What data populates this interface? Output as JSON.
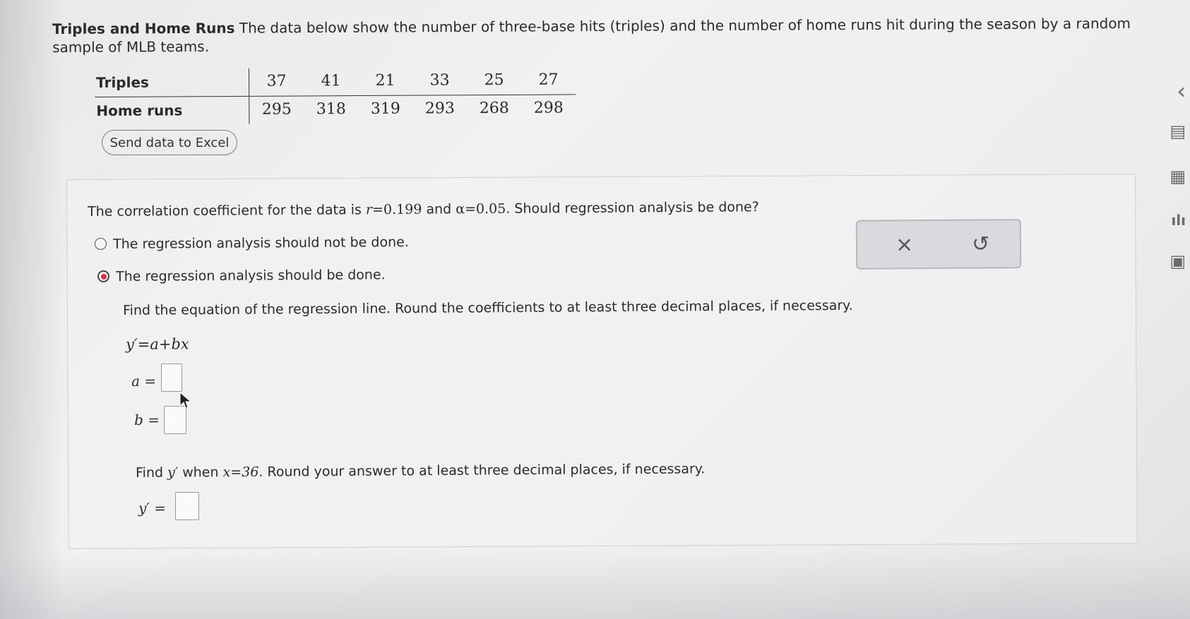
{
  "problem": {
    "title": "Triples and Home Runs",
    "description": "The data below show the number of three-base hits (triples) and the number of home runs hit during the season by a random sample of MLB teams."
  },
  "table": {
    "row1_label": "Triples",
    "row1_values": [
      "37",
      "41",
      "21",
      "33",
      "25",
      "27"
    ],
    "row2_label": "Home runs",
    "row2_values": [
      "295",
      "318",
      "319",
      "293",
      "268",
      "298"
    ]
  },
  "send_excel_label": "Send data to Excel",
  "question1": {
    "prefix": "The correlation coefficient for the data is",
    "r_var": "r",
    "r_eq": "=0.199",
    "mid": "and",
    "alpha": "α=0.05",
    "suffix": ". Should regression analysis be done?"
  },
  "options": [
    {
      "label": "The regression analysis should not be done.",
      "selected": false
    },
    {
      "label": "The regression analysis should be done.",
      "selected": true
    }
  ],
  "question2": {
    "prompt": "Find the equation of the regression line. Round the coefficients to at least three decimal places, if necessary.",
    "equation": "y′=a+bx",
    "a_label": "a =",
    "b_label": "b =",
    "a_value": "",
    "b_value": ""
  },
  "question3": {
    "prefix": "Find",
    "y_var": "y′",
    "when": "when",
    "x_eq": "x=36",
    "suffix": ". Round your answer to at least three decimal places, if necessary.",
    "y_label": "y′ =",
    "y_value": ""
  },
  "actions": {
    "clear_icon": "×",
    "undo_icon": "↺"
  },
  "side_icons": [
    "‹",
    "▤",
    "▦",
    "ılı",
    "▣"
  ],
  "accent_color": "#d8313f"
}
